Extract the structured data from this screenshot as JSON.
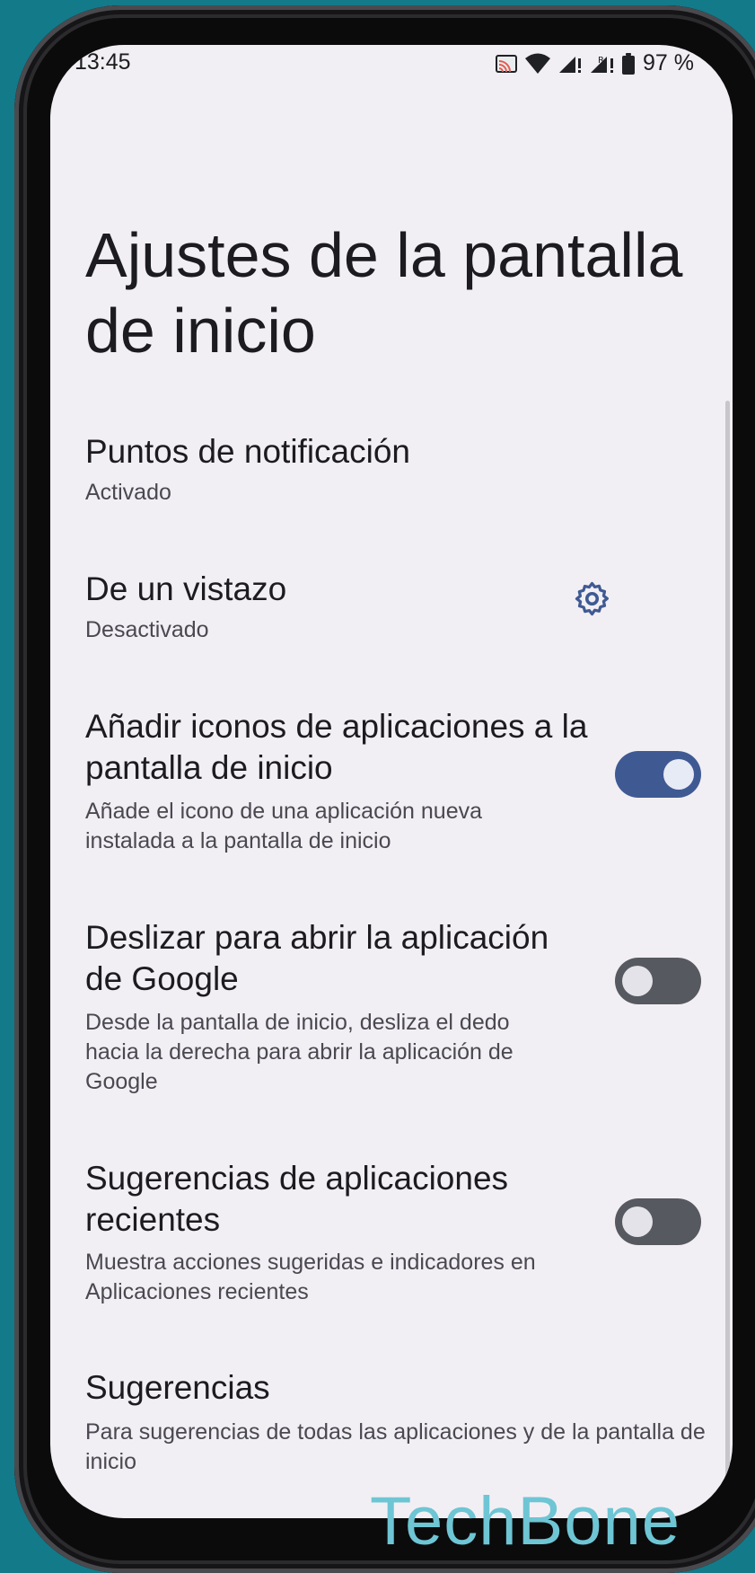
{
  "status_bar": {
    "time": "13:45",
    "battery": "97 %",
    "icons": [
      "cast-icon",
      "wifi-icon",
      "signal-icon",
      "signal-roaming-icon",
      "battery-icon"
    ]
  },
  "page": {
    "title": "Ajustes de la pantalla de inicio"
  },
  "settings": [
    {
      "title": "Puntos de notificación",
      "subtitle": "Activado"
    },
    {
      "title": "De un vistazo",
      "subtitle": "Desactivado",
      "action": "gear-icon"
    },
    {
      "title": "Añadir iconos de aplicaciones a la pantalla de inicio",
      "subtitle": "Añade el icono de una aplicación nueva instalada a la pantalla de inicio",
      "toggle": true
    },
    {
      "title": "Deslizar para abrir la aplicación de Google",
      "subtitle": "Desde la pantalla de inicio, desliza el dedo hacia la derecha para abrir la aplicación de Google",
      "toggle": false
    },
    {
      "title": "Sugerencias de aplicaciones recientes",
      "subtitle": "Muestra acciones sugeridas e indicadores en Aplicaciones recientes",
      "toggle": false
    },
    {
      "title": "Sugerencias",
      "subtitle": "Para sugerencias de todas las aplicaciones y de la pantalla de inicio"
    }
  ],
  "watermark": "TechBone",
  "colors": {
    "background": "#137a8a",
    "screen": "#f2eff4",
    "toggle_on": "#3f5a93",
    "toggle_off": "#56595f",
    "accent_icon": "#3f5a93",
    "watermark": "#6ec5d4"
  }
}
